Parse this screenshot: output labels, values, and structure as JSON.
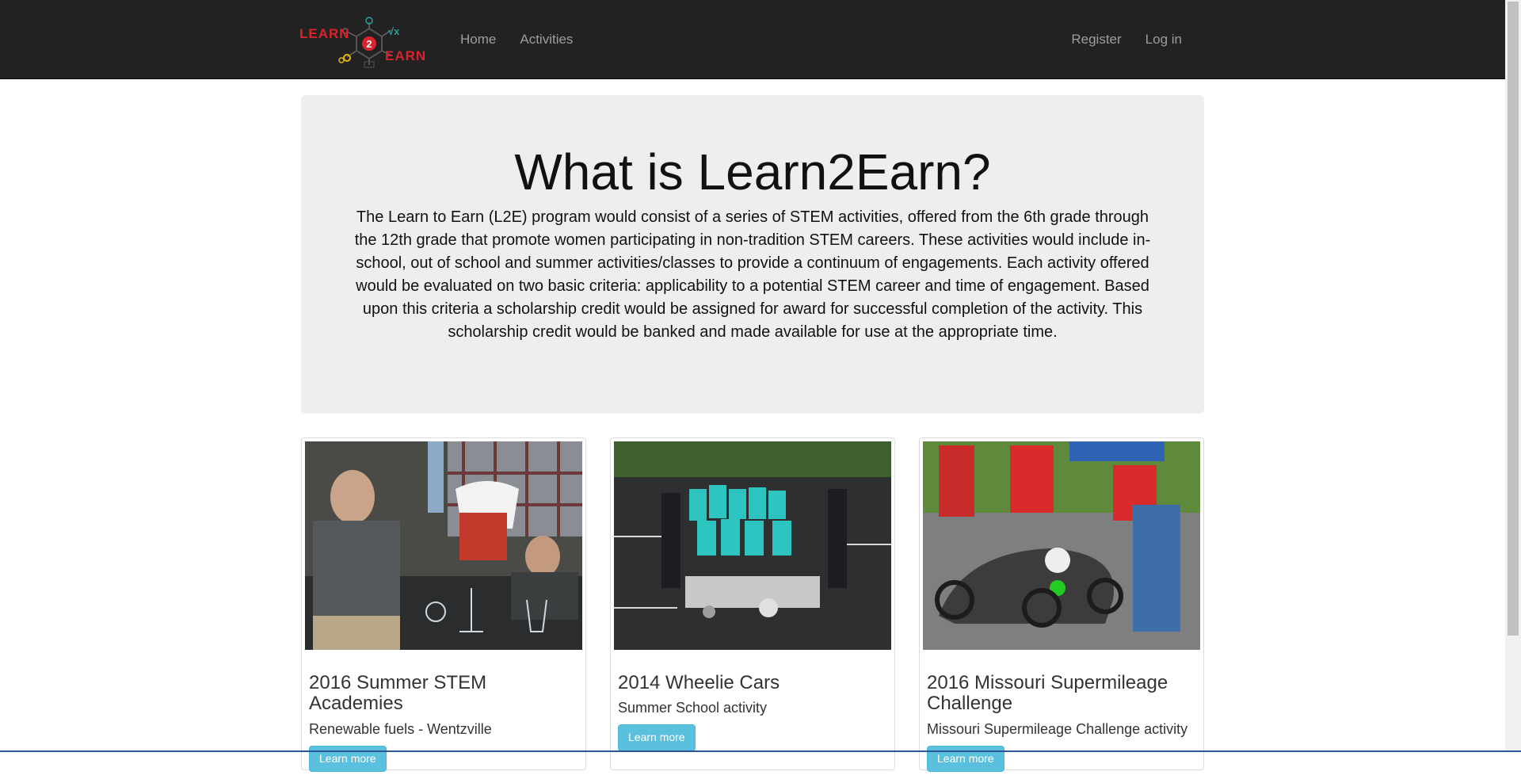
{
  "navbar": {
    "brand": {
      "word1": "LEARN",
      "digit": "2",
      "word2": "EARN",
      "sqrt_symbol": "√x"
    },
    "links_left": [
      "Home",
      "Activities"
    ],
    "links_right": [
      "Register",
      "Log in"
    ]
  },
  "jumbotron": {
    "title": "What is Learn2Earn?",
    "text": "The Learn to Earn (L2E) program would consist of a series of STEM activities, offered from the 6th grade through the 12th grade that promote women participating in non-tradition STEM careers. These activities would include in-school, out of school and summer activities/classes to provide a continuum of engagements. Each activity offered would be evaluated on two basic criteria: applicability to a potential STEM career and time of engagement. Based upon this criteria a scholarship credit would be assigned for award for successful completion of the activity. This scholarship credit would be banked and made available for use at the appropriate time."
  },
  "cards": [
    {
      "title": "2016 Summer STEM Academies",
      "subtitle": "Renewable fuels - Wentzville",
      "button": "Learn more",
      "image": "lab-photo"
    },
    {
      "title": "2014 Wheelie Cars",
      "subtitle": "Summer School activity",
      "button": "Learn more",
      "image": "group-photo"
    },
    {
      "title": "2016 Missouri Supermileage Challenge",
      "subtitle": "Missouri Supermileage Challenge activity",
      "button": "Learn more",
      "image": "race-car-photo"
    }
  ],
  "colors": {
    "navbar_bg": "#222222",
    "nav_link": "#9d9d9d",
    "jumbotron_bg": "#eeeeee",
    "button_info": "#5bc0de",
    "brand_red": "#d9232d",
    "brand_teal": "#2aa198"
  }
}
